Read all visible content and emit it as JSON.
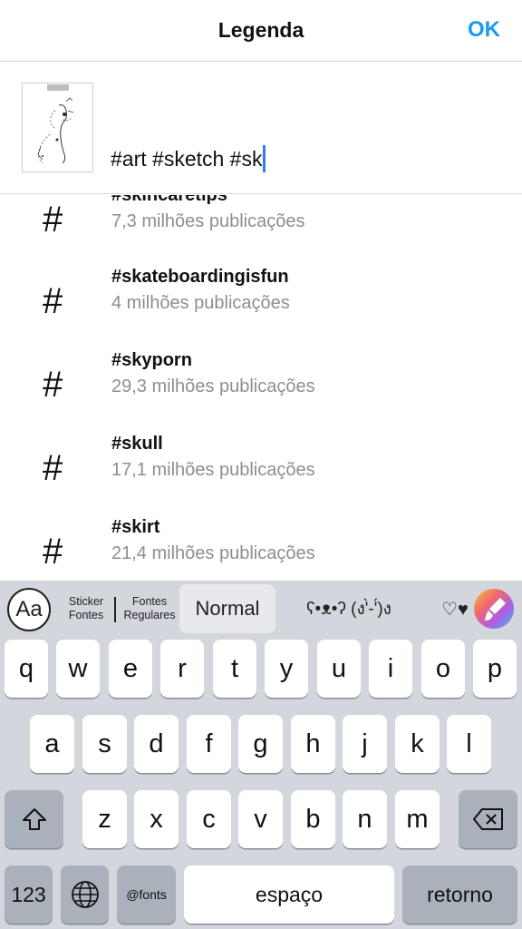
{
  "header": {
    "title": "Legenda",
    "ok_label": "OK"
  },
  "caption": {
    "text": "#art #sketch #sk"
  },
  "suggestions": [
    {
      "tag": "#skincaretips",
      "count": "7,3 milhões publicações"
    },
    {
      "tag": "#skateboardingisfun",
      "count": "4 milhões publicações"
    },
    {
      "tag": "#skyporn",
      "count": "29,3 milhões publicações"
    },
    {
      "tag": "#skull",
      "count": "17,1 milhões publicações"
    },
    {
      "tag": "#skirt",
      "count": "21,4 milhões publicações"
    }
  ],
  "hash_symbol": "#",
  "keyboard_bar": {
    "aa": "Aa",
    "sticker_line1": "Sticker",
    "sticker_line2": "Fontes",
    "fontes_line1": "Fontes",
    "fontes_line2": "Regulares",
    "normal": "Normal",
    "face": "ʕ•ᴥ•ʔ (ง'̀-'́)ง",
    "hearts": "♡♥"
  },
  "keys": {
    "row1": [
      "q",
      "w",
      "e",
      "r",
      "t",
      "y",
      "u",
      "i",
      "o",
      "p"
    ],
    "row2": [
      "a",
      "s",
      "d",
      "f",
      "g",
      "h",
      "j",
      "k",
      "l"
    ],
    "row3": [
      "z",
      "x",
      "c",
      "v",
      "b",
      "n",
      "m"
    ],
    "shift": "⇧",
    "backspace": "⌫",
    "numbers": "123",
    "fonts": "@fonts",
    "space": "espaço",
    "return": "retorno"
  },
  "colors": {
    "accent": "#1a9bf0",
    "cursor": "#3478f6",
    "keyboard_bg": "#d3d6dc"
  }
}
